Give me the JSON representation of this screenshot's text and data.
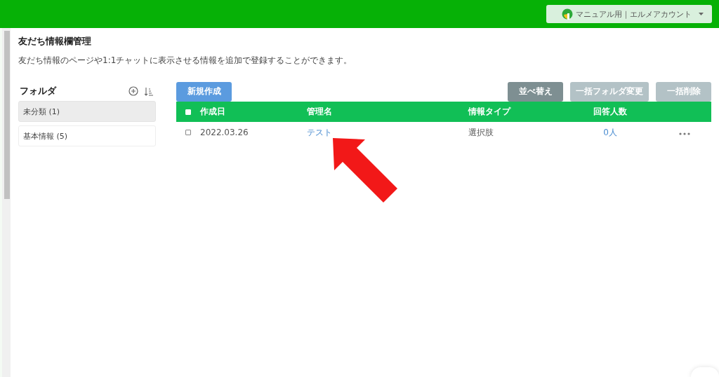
{
  "account_menu": {
    "label": "マニュアル用｜エルメアカウント"
  },
  "page": {
    "title": "友だち情報欄管理",
    "description": "友だち情報のページや1:1チャットに表示させる情報を追加で登録することができます。"
  },
  "folders": {
    "title": "フォルダ",
    "items": [
      {
        "label": "未分類 (1)",
        "selected": true
      },
      {
        "label": "基本情報 (5)",
        "selected": false
      }
    ]
  },
  "toolbar": {
    "create_button": "新規作成",
    "buttons": [
      {
        "label": "並べ替え",
        "disabled": false
      },
      {
        "label": "一括フォルダ変更",
        "disabled": true
      },
      {
        "label": "一括削除",
        "disabled": true
      }
    ]
  },
  "table": {
    "select_all_checked": false,
    "columns": [
      "作成日",
      "管理名",
      "情報タイプ",
      "回答人数"
    ],
    "rows": [
      {
        "checked": false,
        "date": "2022.03.26",
        "name": "テスト",
        "type": "選択肢",
        "respondents": "0人"
      }
    ]
  }
}
